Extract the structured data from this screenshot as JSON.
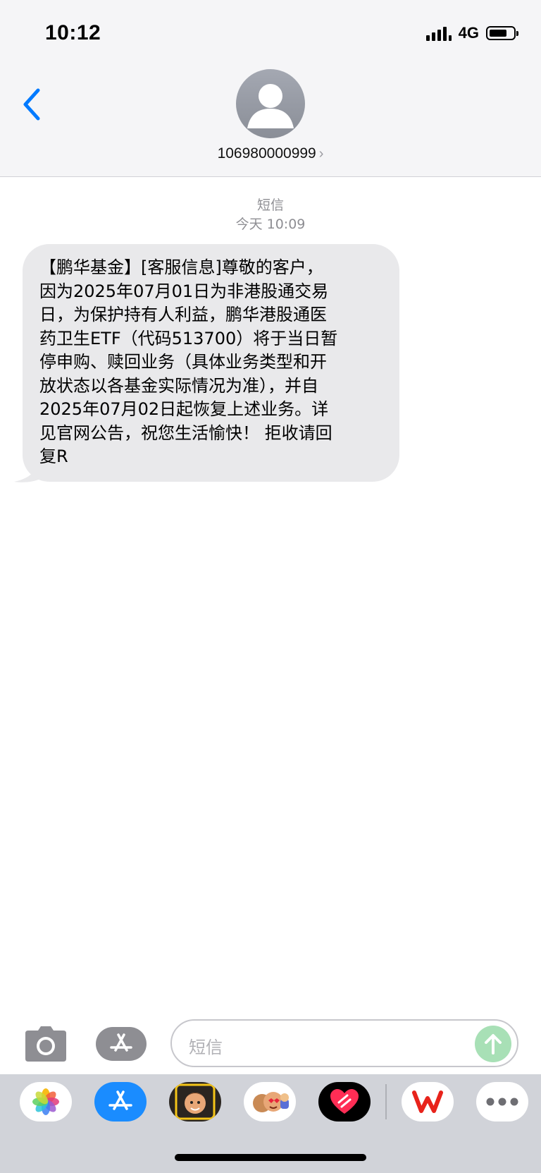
{
  "status_bar": {
    "time": "10:12",
    "network": "4G"
  },
  "header": {
    "contact_number": "106980000999",
    "chevron": "›"
  },
  "conversation": {
    "label": "短信",
    "timestamp": "今天 10:09",
    "message": "【鹏华基金】[客服信息]尊敬的客户，\n因为2025年07月01日为非港股通交易\n日，为保护持有人利益，鹏华港股通医\n药卫生ETF（代码513700）将于当日暂\n停申购、赎回业务（具体业务类型和开\n放状态以各基金实际情况为准），并自\n2025年07月02日起恢复上述业务。详\n见官网公告，祝您生活愉快！ 拒收请回\n复R"
  },
  "input_bar": {
    "placeholder": "短信"
  },
  "colors": {
    "accent": "#007aff",
    "bubble": "#e9e9eb",
    "send": "#a8e0b6"
  },
  "drawer": {
    "apps": [
      "photos-app-icon",
      "app-store-icon",
      "memoji-icon",
      "stickers-icon",
      "digital-touch-icon",
      "wps-icon",
      "more-icon"
    ]
  }
}
